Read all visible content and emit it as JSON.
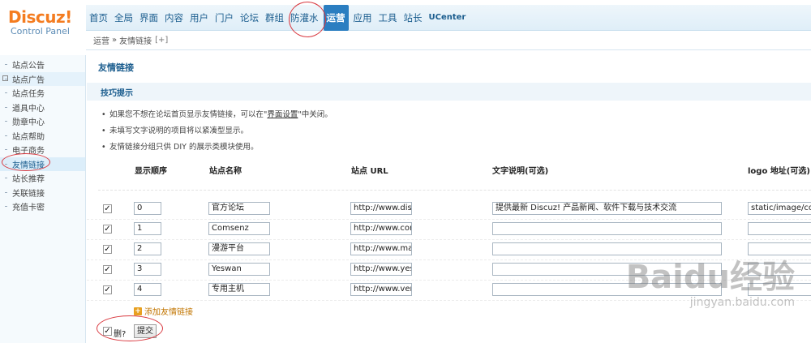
{
  "logo": {
    "main": "Discuz!",
    "sub": "Control Panel"
  },
  "topnav": [
    {
      "label": "首页",
      "active": false
    },
    {
      "label": "全局",
      "active": false
    },
    {
      "label": "界面",
      "active": false
    },
    {
      "label": "内容",
      "active": false
    },
    {
      "label": "用户",
      "active": false
    },
    {
      "label": "门户",
      "active": false
    },
    {
      "label": "论坛",
      "active": false
    },
    {
      "label": "群组",
      "active": false
    },
    {
      "label": "防灌水",
      "active": false
    },
    {
      "label": "运营",
      "active": true
    },
    {
      "label": "应用",
      "active": false
    },
    {
      "label": "工具",
      "active": false
    },
    {
      "label": "站长",
      "active": false
    },
    {
      "label": "UCenter",
      "active": false
    }
  ],
  "breadcrumb": {
    "root": "运营",
    "separator": "»",
    "current": "友情链接",
    "plus": "[+]"
  },
  "sidebar": [
    {
      "label": "站点公告"
    },
    {
      "label": "站点广告"
    },
    {
      "label": "站点任务"
    },
    {
      "label": "道具中心"
    },
    {
      "label": "勋章中心"
    },
    {
      "label": "站点帮助"
    },
    {
      "label": "电子商务"
    },
    {
      "label": "友情链接"
    },
    {
      "label": "站长推荐"
    },
    {
      "label": "关联链接"
    },
    {
      "label": "充值卡密"
    }
  ],
  "page_title": "友情链接",
  "tips_title": "技巧提示",
  "tips": {
    "t1_pre": "如果您不想在论坛首页显示友情链接，可以在\"",
    "t1_link": "界面设置",
    "t1_post": "\"中关闭。",
    "t2": "未填写文字说明的项目将以紧凑型显示。",
    "t3": "友情链接分组只供 DIY 的展示类模块使用。"
  },
  "columns": {
    "order": "显示顺序",
    "name": "站点名称",
    "url": "站点 URL",
    "desc": "文字说明(可选)",
    "logo": "logo 地址(可选)"
  },
  "rows": [
    {
      "checked": true,
      "order": "0",
      "name": "官方论坛",
      "url": "http://www.discu",
      "desc": "提供最新 Discuz! 产品新闻、软件下载与技术交流",
      "logo": "static/image/com"
    },
    {
      "checked": true,
      "order": "1",
      "name": "Comsenz",
      "url": "http://www.com",
      "desc": "",
      "logo": ""
    },
    {
      "checked": true,
      "order": "2",
      "name": "漫游平台",
      "url": "http://www.man",
      "desc": "",
      "logo": ""
    },
    {
      "checked": true,
      "order": "3",
      "name": "Yeswan",
      "url": "http://www.yesv",
      "desc": "",
      "logo": ""
    },
    {
      "checked": true,
      "order": "4",
      "name": "专用主机",
      "url": "http://www.very",
      "desc": "",
      "logo": ""
    }
  ],
  "add_link": "添加友情链接",
  "footer": {
    "delete_label": "删?",
    "delete_checked": true,
    "submit_label": "提交"
  },
  "watermark": {
    "logo": "Baidu经验",
    "url": "jingyan.baidu.com"
  },
  "colors": {
    "accent": "#2b7ec1",
    "title": "#1b5d8e",
    "annotation": "#d9383f",
    "logo": "#f47c20"
  }
}
